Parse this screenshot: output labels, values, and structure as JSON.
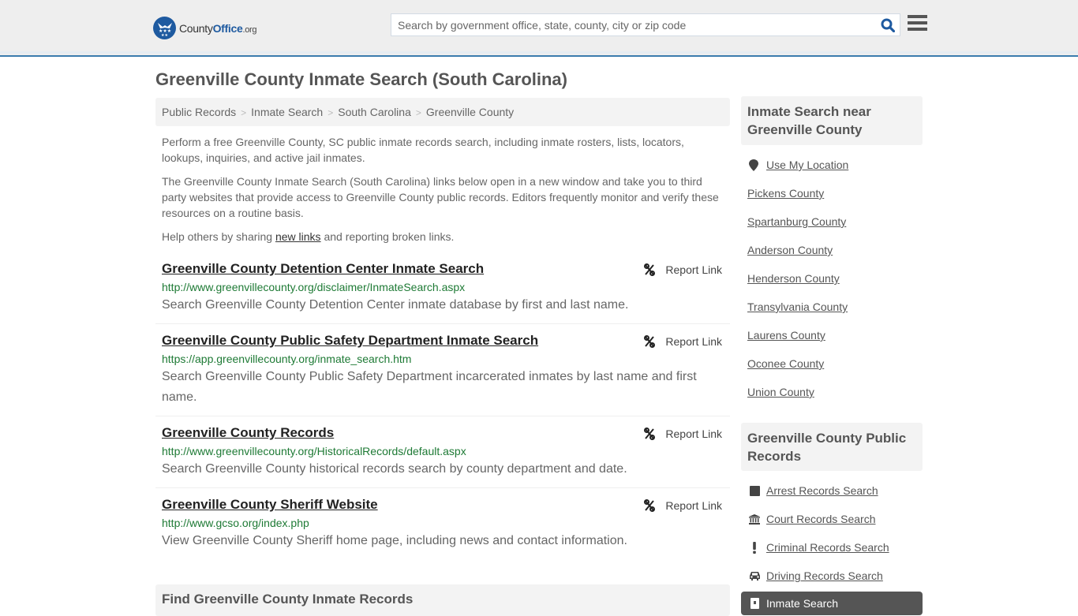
{
  "header": {
    "logo_county": "County",
    "logo_office": "Office",
    "logo_org": ".org",
    "search_placeholder": "Search by government office, state, county, city or zip code",
    "search_icon": "search-icon",
    "menu_icon": "hamburger-menu-icon"
  },
  "page": {
    "title": "Greenville County Inmate Search (South Carolina)"
  },
  "breadcrumb": [
    "Public Records",
    "Inmate Search",
    "South Carolina",
    "Greenville County"
  ],
  "breadcrumb_separator": ">",
  "intro": {
    "p1": "Perform a free Greenville County, SC public inmate records search, including inmate rosters, lists, locators, lookups, inquiries, and active jail inmates.",
    "p2": "The Greenville County Inmate Search (South Carolina) links below open in a new window and take you to third party websites that provide access to Greenville County public records. Editors frequently monitor and verify these resources on a routine basis.",
    "p3_before": "Help others by sharing ",
    "p3_link": "new links",
    "p3_after": " and reporting broken links."
  },
  "report_label": "Report Link",
  "results": [
    {
      "title": "Greenville County Detention Center Inmate Search",
      "url": "http://www.greenvillecounty.org/disclaimer/InmateSearch.aspx",
      "description": "Search Greenville County Detention Center inmate database by first and last name."
    },
    {
      "title": "Greenville County Public Safety Department Inmate Search",
      "url": "https://app.greenvillecounty.org/inmate_search.htm",
      "description": "Search Greenville County Public Safety Department incarcerated inmates by last name and first name."
    },
    {
      "title": "Greenville County Records",
      "url": "http://www.greenvillecounty.org/HistoricalRecords/default.aspx",
      "description": "Search Greenville County historical records search by county department and date."
    },
    {
      "title": "Greenville County Sheriff Website",
      "url": "http://www.gcso.org/index.php",
      "description": "View Greenville County Sheriff home page, including news and contact information."
    }
  ],
  "find_heading": "Find Greenville County Inmate Records",
  "sidebar": {
    "nearby_heading": "Inmate Search near Greenville County",
    "use_location": "Use My Location",
    "nearby": [
      "Pickens County",
      "Spartanburg County",
      "Anderson County",
      "Henderson County",
      "Transylvania County",
      "Laurens County",
      "Oconee County",
      "Union County"
    ],
    "records_heading": "Greenville County Public Records",
    "records": [
      {
        "label": "Arrest Records Search",
        "icon": "book-icon"
      },
      {
        "label": "Court Records Search",
        "icon": "courthouse-icon"
      },
      {
        "label": "Criminal Records Search",
        "icon": "exclamation-icon"
      },
      {
        "label": "Driving Records Search",
        "icon": "car-icon"
      }
    ],
    "active_item": "Inmate Search"
  }
}
